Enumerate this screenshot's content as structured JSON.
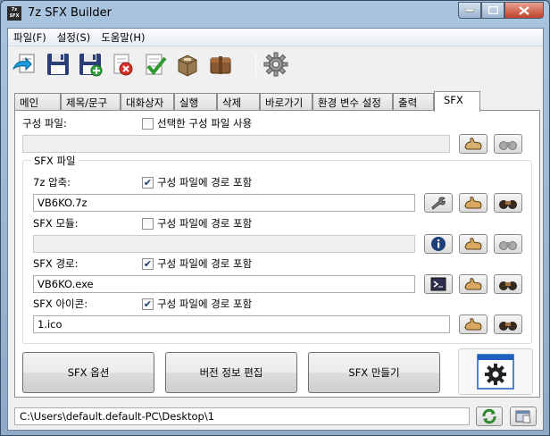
{
  "window": {
    "title": "7z SFX Builder",
    "app_icon_text": "7z\nSFX"
  },
  "menu": [
    {
      "label": "파일(F)"
    },
    {
      "label": "설정(S)"
    },
    {
      "label": "도움말(H)"
    }
  ],
  "tabs": [
    "메인",
    "제목/문구",
    "대화상자",
    "실행",
    "삭제",
    "바로가기",
    "환경 변수 설정",
    "출력",
    "SFX"
  ],
  "active_tab": "SFX",
  "sfx": {
    "config_label": "구성 파일:",
    "config_checkbox": "선택한 구성 파일 사용",
    "config_checked": false,
    "config_value": "",
    "group_title": "SFX 파일",
    "archive_label": "7z 압축:",
    "archive_checkbox": "구성 파일에 경로 포함",
    "archive_checked": true,
    "archive_value": "VB6KO.7z",
    "module_label": "SFX 모듈:",
    "module_checkbox": "구성 파일에 경로 포함",
    "module_checked": false,
    "module_value": "",
    "path_label": "SFX 경로:",
    "path_checkbox": "구성 파일에 경로 포함",
    "path_checked": true,
    "path_value": "VB6KO.exe",
    "icon_label": "SFX 아이콘:",
    "icon_checkbox": "구성 파일에 경로 포함",
    "icon_checked": true,
    "icon_value": "1.ico"
  },
  "buttons": {
    "sfx_options": "SFX 옵션",
    "version_edit": "버전 정보 편집",
    "make_sfx": "SFX 만들기"
  },
  "status": {
    "path": "C:\\Users\\default.default-PC\\Desktop\\1"
  },
  "colors": {
    "accent": "#1f5fbf",
    "window_frame": "#a9c4de"
  }
}
